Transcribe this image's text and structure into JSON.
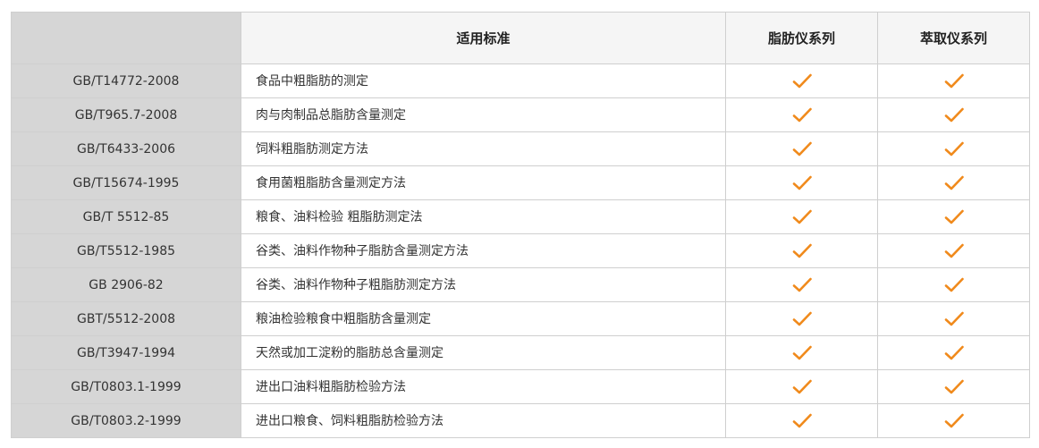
{
  "colors": {
    "accent_check": "#f08a1c",
    "code_column_bg": "#d6d6d6",
    "border": "#cfcfcf"
  },
  "header": {
    "corner": "",
    "standard": "适用标准",
    "fat_series": "脂肪仪系列",
    "extraction_series": "萃取仪系列"
  },
  "rows": [
    {
      "code": "GB/T14772-2008",
      "desc": "食品中粗脂肪的测定",
      "fat": true,
      "extraction": true
    },
    {
      "code": "GB/T965.7-2008",
      "desc": "肉与肉制品总脂肪含量测定",
      "fat": true,
      "extraction": true
    },
    {
      "code": "GB/T6433-2006",
      "desc": "饲料粗脂肪测定方法",
      "fat": true,
      "extraction": true
    },
    {
      "code": "GB/T15674-1995",
      "desc": "食用菌粗脂肪含量测定方法",
      "fat": true,
      "extraction": true
    },
    {
      "code": "GB/T 5512-85",
      "desc": "粮食、油料检验 粗脂肪测定法",
      "fat": true,
      "extraction": true
    },
    {
      "code": "GB/T5512-1985",
      "desc": "谷类、油料作物种子脂肪含量测定方法",
      "fat": true,
      "extraction": true
    },
    {
      "code": "GB 2906-82",
      "desc": "谷类、油料作物种子粗脂肪测定方法",
      "fat": true,
      "extraction": true
    },
    {
      "code": "GBT/5512-2008",
      "desc": "粮油检验粮食中粗脂肪含量测定",
      "fat": true,
      "extraction": true
    },
    {
      "code": "GB/T3947-1994",
      "desc": "天然或加工淀粉的脂肪总含量测定",
      "fat": true,
      "extraction": true
    },
    {
      "code": "GB/T0803.1-1999",
      "desc": "进出口油料粗脂肪检验方法",
      "fat": true,
      "extraction": true
    },
    {
      "code": "GB/T0803.2-1999",
      "desc": "进出口粮食、饲料粗脂肪检验方法",
      "fat": true,
      "extraction": true
    }
  ]
}
